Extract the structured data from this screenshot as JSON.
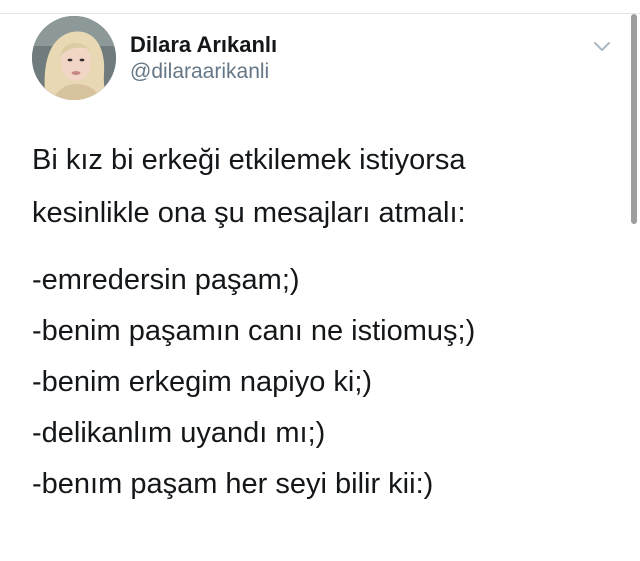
{
  "tweet": {
    "author": {
      "display_name": "Dilara Arıkanlı",
      "handle": "@dilaraarikanli",
      "avatar_icon": "profile-photo"
    },
    "menu_icon": "chevron-down-icon",
    "text_lines": [
      "Bi kız bi erkeği etkilemek istiyorsa",
      "kesinlikle ona şu mesajları atmalı:",
      "-emredersin paşam;)",
      "-benim paşamın canı ne istiomuş;)",
      "-benim erkegim napiyo ki;)",
      "-delikanlım uyandı mı;)",
      "-benım paşam her seyi bilir kii:)"
    ]
  },
  "colors": {
    "name": "#14171a",
    "handle": "#657786",
    "chevron": "#aab8c2",
    "background": "#ffffff"
  }
}
